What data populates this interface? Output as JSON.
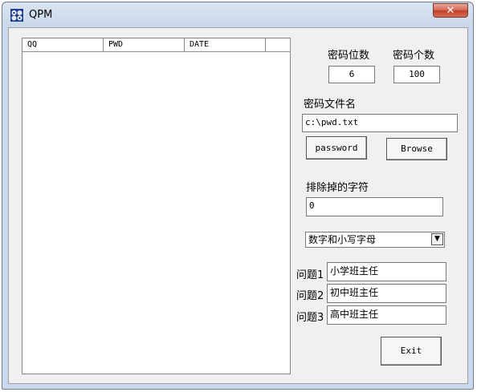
{
  "window": {
    "title": "QPM",
    "close_glyph": "✕"
  },
  "list": {
    "columns": [
      "QQ",
      "PWD",
      "DATE",
      ""
    ]
  },
  "settings": {
    "length_label": "密码位数",
    "length_value": "6",
    "count_label": "密码个数",
    "count_value": "100",
    "file_label": "密码文件名",
    "file_value": "c:\\pwd.txt",
    "password_button": "password",
    "browse_button": "Browse",
    "exclude_label": "排除掉的字符",
    "exclude_value": "0",
    "charset_selected": "数字和小写字母",
    "q1_label": "问题1",
    "q1_value": "小学班主任",
    "q2_label": "问题2",
    "q2_value": "初中班主任",
    "q3_label": "问题3",
    "q3_value": "高中班主任",
    "exit_button": "Exit"
  },
  "icons": {
    "app": "qpm-app-icon",
    "dropdown": "dropdown-arrow-icon",
    "close": "close-icon"
  }
}
